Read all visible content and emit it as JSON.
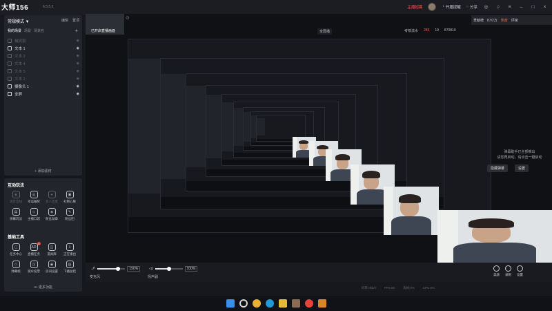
{
  "app": {
    "name": "大师156",
    "version": "6.5.5.2"
  },
  "topbar": {
    "live_room": "主播招募",
    "start_remind": "开播提醒",
    "share": "分享"
  },
  "left_panel": {
    "mode": "常规模式 ▼",
    "edit": "编辑",
    "pin": "置顶",
    "tabs": [
      "我的场景",
      "场景",
      "场景名"
    ],
    "sources": [
      {
        "label": "捕捉窗",
        "dim": true
      },
      {
        "label": "文本 1",
        "dim": false
      },
      {
        "label": "文本 3",
        "dim": true
      },
      {
        "label": "文本 4",
        "dim": true
      },
      {
        "label": "文本 5",
        "dim": true
      },
      {
        "label": "文本 2",
        "dim": true
      },
      {
        "label": "摄像头 1",
        "dim": false
      },
      {
        "label": "全屏",
        "dim": false
      }
    ],
    "add_source": "+ 添加素材"
  },
  "interact": {
    "title": "互动玩法",
    "tools": [
      {
        "label": "语音连线",
        "dim": true,
        "icon": "mic-icon",
        "glyph": "◉"
      },
      {
        "label": "幸运抽奖",
        "dim": false,
        "icon": "lottery-icon",
        "glyph": "◎"
      },
      {
        "label": "多人连麦",
        "dim": true,
        "icon": "multi-icon",
        "glyph": "♣"
      },
      {
        "label": "礼物心愿",
        "dim": false,
        "icon": "gift-icon",
        "glyph": "▣"
      },
      {
        "label": "弹幕玩法",
        "dim": false,
        "icon": "danmaku-icon",
        "glyph": "▤"
      },
      {
        "label": "主播口袋",
        "dim": false,
        "icon": "pocket-icon",
        "glyph": "◇"
      },
      {
        "label": "粉丝勋章",
        "dim": false,
        "icon": "badge-icon",
        "glyph": "◈"
      },
      {
        "label": "粉丝团",
        "dim": false,
        "icon": "fans-icon",
        "glyph": "✎"
      }
    ]
  },
  "basic": {
    "title": "基础工具",
    "tools": [
      {
        "label": "任务中心",
        "icon": "task-icon",
        "glyph": "▢",
        "badge": ""
      },
      {
        "label": "直播任务",
        "icon": "live-task-icon",
        "glyph": "AD",
        "badge": "1"
      },
      {
        "label": "道具库",
        "icon": "props-icon",
        "glyph": "◫",
        "badge": ""
      },
      {
        "label": "正在播出",
        "icon": "download-icon",
        "glyph": "⇩",
        "badge": ""
      },
      {
        "label": "弹幕姬",
        "icon": "danmaku-ji-icon",
        "glyph": "▭",
        "badge": ""
      },
      {
        "label": "观众投票",
        "icon": "vote-icon",
        "glyph": "◳",
        "badge": ""
      },
      {
        "label": "房间设置",
        "icon": "room-icon",
        "glyph": "◉",
        "badge": ""
      },
      {
        "label": "下播总结",
        "icon": "summary-icon",
        "glyph": "▤",
        "badge": ""
      }
    ],
    "more": "••• 更多功能"
  },
  "preview": {
    "caption": "已开启直播画面",
    "scene_mode": "全屏播",
    "stats": {
      "exam": "考核流水",
      "exam_val": "285",
      "hearts": "19",
      "views": "870810"
    },
    "overlay_text": "弹幕助手已全部推出\n请您再启动，请点击一键启动",
    "btn_hide": "隐藏弹幕",
    "btn_settings": "设置"
  },
  "contrib": {
    "label": "贡献榜",
    "value": "87/2万",
    "score": "热度",
    "rate": "评级"
  },
  "audio": {
    "mic": {
      "label": "麦克风",
      "pct": "150%",
      "level": 0.75
    },
    "speaker": {
      "label": "扬声器",
      "pct": "100%",
      "level": 0.5
    }
  },
  "actions": [
    {
      "label": "美颜",
      "icon": "beauty-icon"
    },
    {
      "label": "录制",
      "icon": "record-icon"
    },
    {
      "label": "设置",
      "icon": "settings-icon"
    }
  ],
  "status": {
    "bitrate": "码率:0kb/s",
    "fps": "FPS:60",
    "drop": "丢帧:0%",
    "cpu": "CPU:0%"
  },
  "taskbar": {
    "icons": [
      {
        "name": "windows-icon",
        "color": "#3b8fe6"
      },
      {
        "name": "search-icon",
        "color": "#d8d8d8"
      },
      {
        "name": "chrome-icon",
        "color": "#e9b131"
      },
      {
        "name": "edge-icon",
        "color": "#1f9ad6"
      },
      {
        "name": "explorer-icon",
        "color": "#e5b93a"
      },
      {
        "name": "app-avatar-icon",
        "color": "#8a6b55"
      },
      {
        "name": "stream-app-icon",
        "color": "#e5433a"
      },
      {
        "name": "game-icon",
        "color": "#d8862a"
      }
    ]
  }
}
